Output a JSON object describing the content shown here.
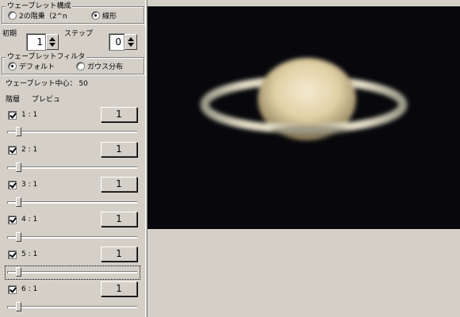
{
  "wavelet_config": {
    "title": "ウェーブレット構成",
    "options": [
      {
        "label": "2の階乗（2^n",
        "selected": false
      },
      {
        "label": "線形",
        "selected": true
      }
    ],
    "initial_label": "初期",
    "initial_value": "1",
    "step_label": "ステップ",
    "step_value": "0"
  },
  "wavelet_filter": {
    "title": "ウェーブレットフィルタ",
    "options": [
      {
        "label": "デフォルト",
        "selected": true
      },
      {
        "label": "ガウス分布",
        "selected": false
      }
    ]
  },
  "wavelet_center_label": "ウェーブレット中心：",
  "wavelet_center_value": "50",
  "layers_header": "階層",
  "preview_header": "プレビュ",
  "levels": [
    {
      "label": "1 : 1",
      "button": "1",
      "checked": true,
      "slider": 0.05
    },
    {
      "label": "2 : 1",
      "button": "1",
      "checked": true,
      "slider": 0.05
    },
    {
      "label": "3 : 1",
      "button": "1",
      "checked": true,
      "slider": 0.05
    },
    {
      "label": "4 : 1",
      "button": "1",
      "checked": true,
      "slider": 0.05
    },
    {
      "label": "5 : 1",
      "button": "1",
      "checked": true,
      "slider": 0.05
    },
    {
      "label": "6 : 1",
      "button": "1",
      "checked": true,
      "slider": 0.05
    }
  ],
  "colors": {
    "panel": "#d4d0c8",
    "preview_bg": "#08080c",
    "planet": "#e9dcb0",
    "ring": "#d8d2b8"
  },
  "preview_subject": "saturn-image"
}
